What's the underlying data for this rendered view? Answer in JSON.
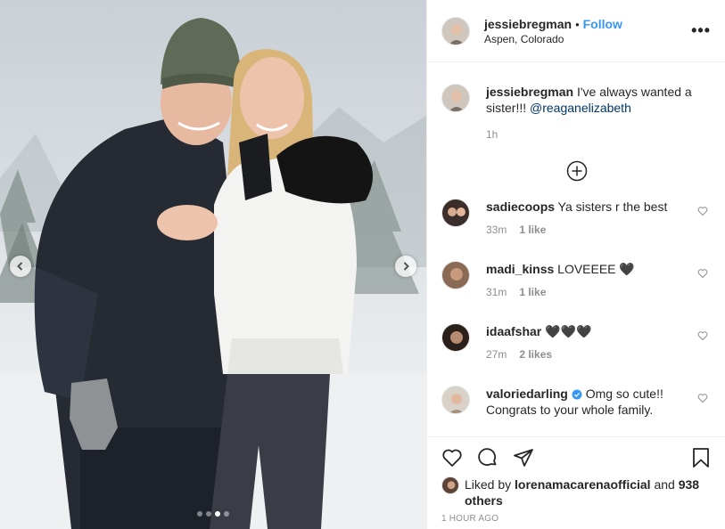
{
  "post": {
    "username": "jessiebregman",
    "separator": "•",
    "follow_label": "Follow",
    "location": "Aspen, Colorado",
    "more_label": "•••",
    "carousel": {
      "slide_count": 4,
      "active_slide": 3
    }
  },
  "caption": {
    "username": "jessiebregman",
    "text": "I've always wanted a sister!!!",
    "mention": "@reaganelizabeth",
    "time": "1h"
  },
  "comments": [
    {
      "username": "sadiecoops",
      "text": "Ya sisters r the best",
      "time": "33m",
      "likes": "1 like",
      "verified": false
    },
    {
      "username": "madi_kinss",
      "text": "LOVEEEE 🖤",
      "time": "31m",
      "likes": "1 like",
      "verified": false
    },
    {
      "username": "idaafshar",
      "text": "🖤🖤🖤",
      "time": "27m",
      "likes": "2 likes",
      "verified": false
    },
    {
      "username": "valoriedarling",
      "text": "Omg so cute!! Congrats to your whole family.",
      "time": "",
      "likes": "",
      "verified": true
    }
  ],
  "footer": {
    "liked_prefix": "Liked by",
    "liked_user": "lorenamacarenaofficial",
    "liked_and": "and",
    "liked_others": "938 others",
    "posted_ago": "1 HOUR AGO"
  },
  "icons": [
    "heart-icon",
    "comment-icon",
    "share-icon",
    "bookmark-icon",
    "chevron-left-icon",
    "chevron-right-icon",
    "plus-circle-icon",
    "verified-badge-icon",
    "more-options-icon"
  ],
  "colors": {
    "link": "#3897f0",
    "mention": "#003569",
    "muted": "#8e8e8e",
    "text": "#262626",
    "border": "#efefef",
    "verified": "#3897f0"
  }
}
